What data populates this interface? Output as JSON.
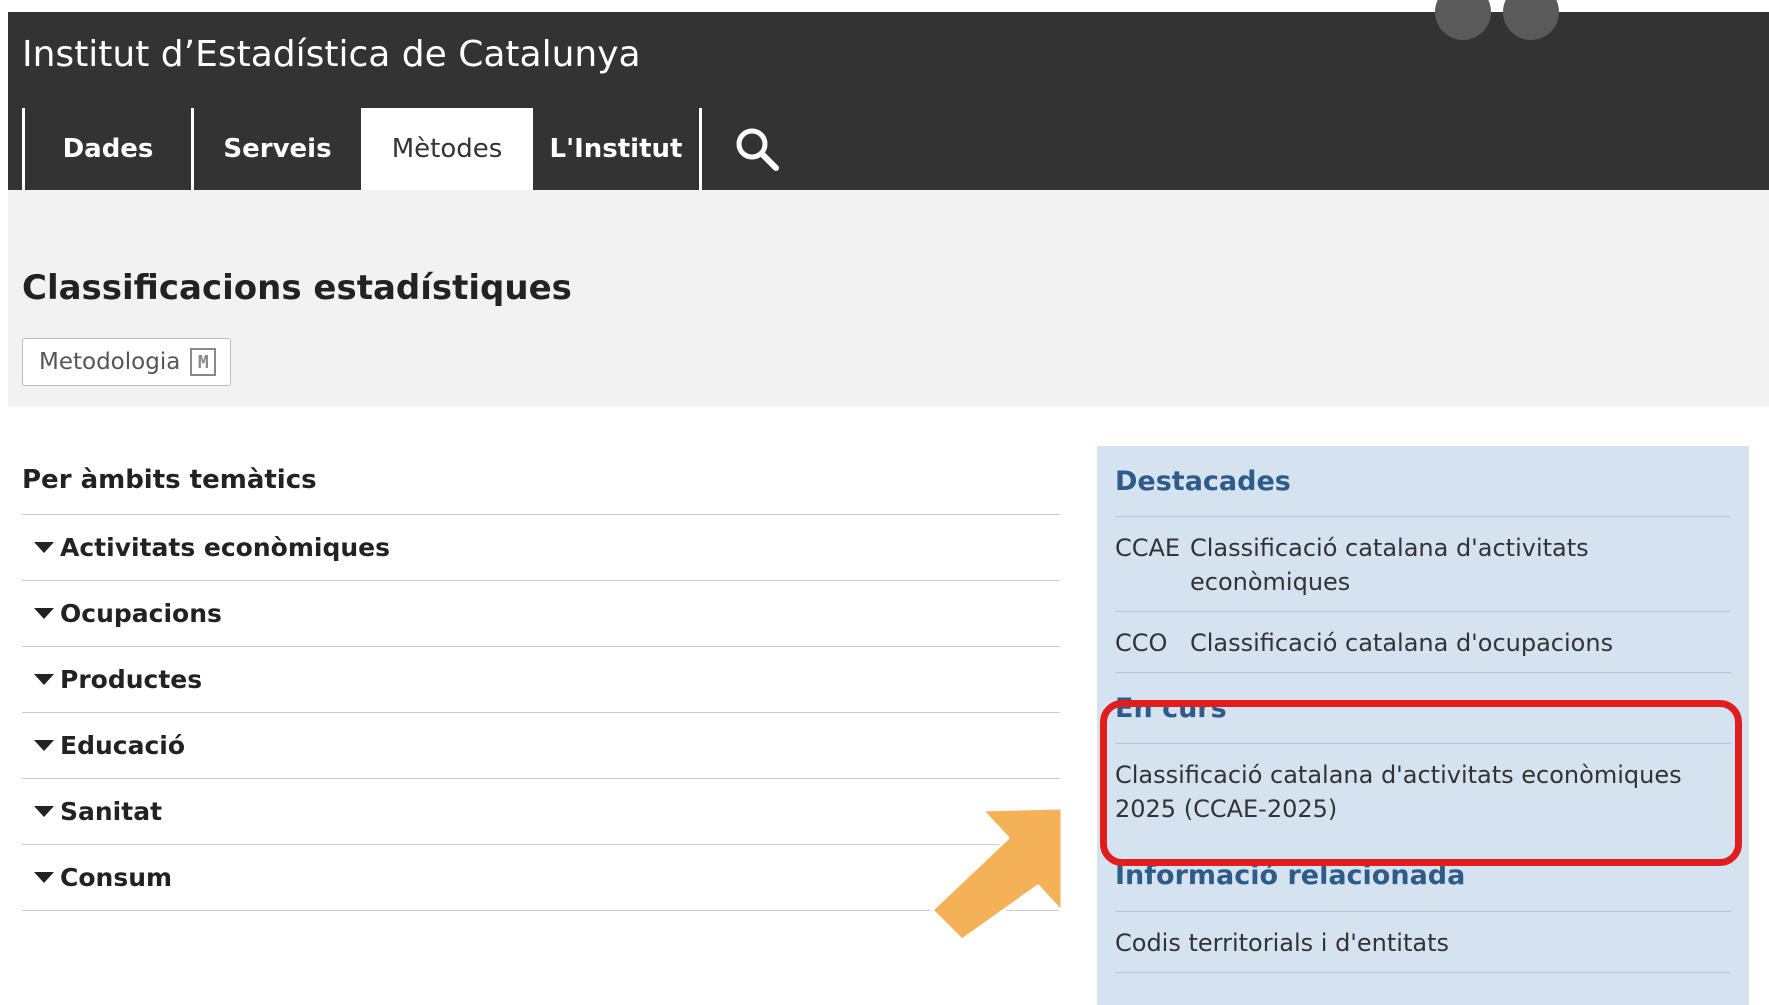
{
  "header": {
    "site_title": "Institut d’Estadística de Catalunya",
    "nav": [
      {
        "label": "Dades",
        "active": false
      },
      {
        "label": "Serveis",
        "active": false
      },
      {
        "label": "Mètodes",
        "active": true
      },
      {
        "label": "L'Institut",
        "active": false
      }
    ],
    "search_icon": "search-icon"
  },
  "banner": {
    "title": "Classificacions estadístiques",
    "metodologia_label": "Metodologia",
    "metodologia_icon_letter": "M"
  },
  "themes": {
    "title": "Per àmbits temàtics",
    "items": [
      "Activitats econòmiques",
      "Ocupacions",
      "Productes",
      "Educació",
      "Sanitat",
      "Consum"
    ]
  },
  "panel": {
    "destacades": {
      "heading": "Destacades",
      "items": [
        {
          "abbr": "CCAE",
          "label": "Classificació catalana d'activitats econòmiques"
        },
        {
          "abbr": "CCO",
          "label": "Classificació catalana d'ocupacions"
        }
      ]
    },
    "en_curs": {
      "heading": "En curs",
      "items": [
        "Classificació catalana d'activitats econòmiques 2025 (CCAE-2025)"
      ]
    },
    "relacionada": {
      "heading": "Informació relacionada",
      "items": [
        "Codis territorials i d'entitats"
      ]
    }
  },
  "colors": {
    "header_bg": "#333333",
    "panel_bg": "#d5e2ef",
    "heading_blue": "#2e5c8a",
    "highlight_red": "#e01e1e",
    "arrow_orange": "#f5b157"
  }
}
